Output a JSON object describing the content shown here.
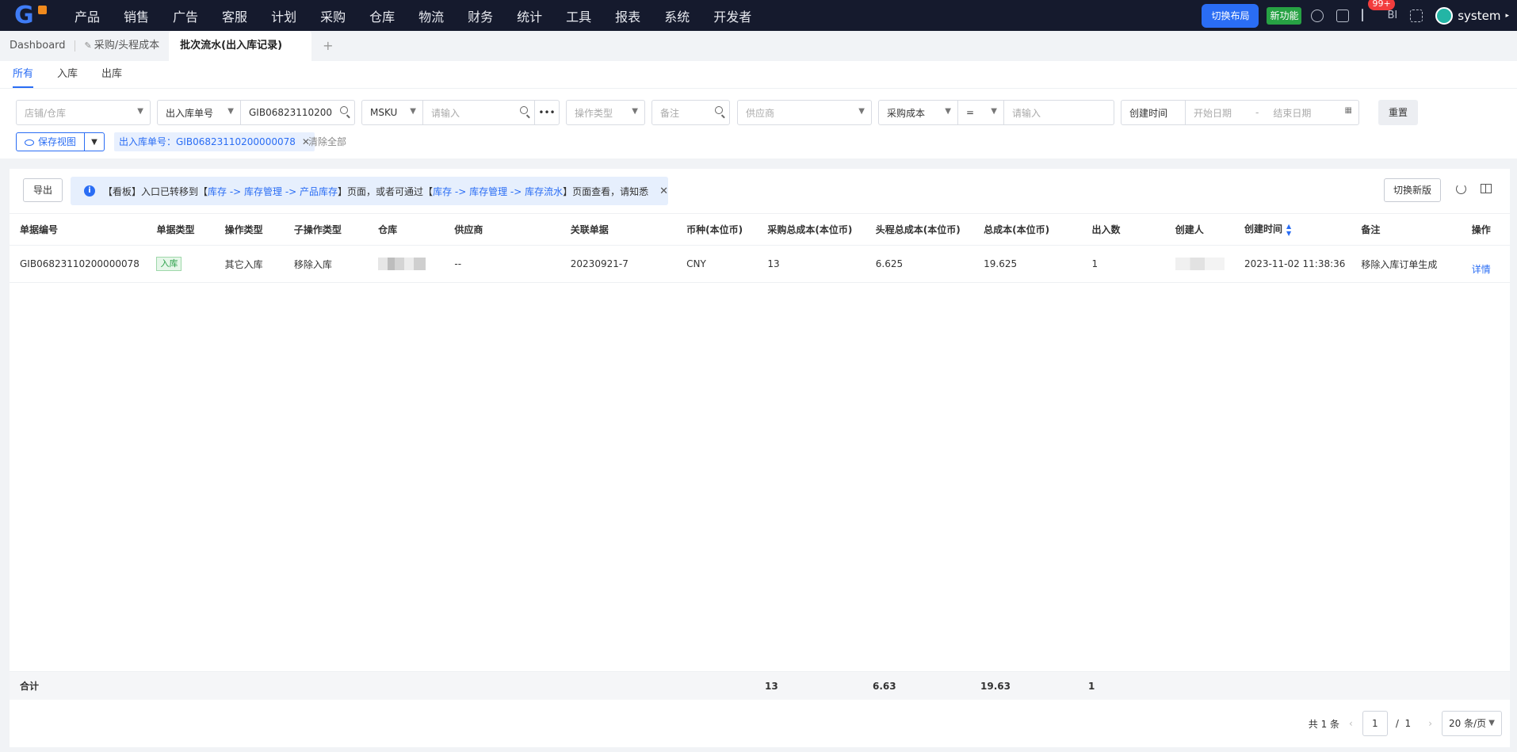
{
  "topnav": {
    "menu": [
      "产品",
      "销售",
      "广告",
      "客服",
      "计划",
      "采购",
      "仓库",
      "物流",
      "财务",
      "统计",
      "工具",
      "报表",
      "系统",
      "开发者"
    ],
    "switch_layout": "切换布局",
    "new_feature": "新功能",
    "badge": "99+",
    "bi_label": "BI",
    "user": "system"
  },
  "tabs": {
    "dashboard": "Dashboard",
    "purchase": "采购/头程成本",
    "active": "批次流水(出入库记录)",
    "add": "+"
  },
  "subtabs": [
    "所有",
    "入库",
    "出库"
  ],
  "filters": {
    "shop_warehouse": "店铺/仓库",
    "doc_no_type": "出入库单号",
    "doc_no_value": "GIB06823110200",
    "msku": "MSKU",
    "msku_placeholder": "请输入",
    "op_type": "操作类型",
    "remark": "备注",
    "supplier": "供应商",
    "cost_type": "采购成本",
    "operator": "=",
    "cost_placeholder": "请输入",
    "time_type": "创建时间",
    "start_date": "开始日期",
    "dash": "-",
    "end_date": "结束日期",
    "reset": "重置",
    "save_view": "保存视图",
    "active_tag": "出入库单号：GIB06823110200000078",
    "clear_all": "清除全部"
  },
  "toolbar": {
    "export": "导出",
    "notice_prefix": "【看板】入口已转移到【",
    "notice_link1": "库存 -> 库存管理 -> 产品库存",
    "notice_mid": "】页面，或者可通过【",
    "notice_link2": "库存 -> 库存管理 -> 库存流水",
    "notice_suffix": "】页面查看，请知悉",
    "switch_new": "切换新版"
  },
  "table": {
    "columns": [
      "单据编号",
      "单据类型",
      "操作类型",
      "子操作类型",
      "仓库",
      "供应商",
      "关联单据",
      "币种(本位币)",
      "采购总成本(本位币)",
      "头程总成本(本位币)",
      "总成本(本位币)",
      "出入数",
      "创建人",
      "创建时间",
      "备注",
      "操作"
    ],
    "rows": [
      {
        "doc_no": "GIB06823110200000078",
        "doc_type": "入库",
        "op_type": "其它入库",
        "sub_op_type": "移除入库",
        "supplier": "--",
        "related": "20230921-7",
        "currency": "CNY",
        "purchase_cost": "13",
        "first_leg_cost": "6.625",
        "total_cost": "19.625",
        "qty": "1",
        "created_at": "2023-11-02 11:38:36",
        "remark": "移除入库订单生成",
        "action": "详情"
      }
    ],
    "summary": {
      "label": "合计",
      "purchase_cost": "13",
      "first_leg_cost": "6.63",
      "total_cost": "19.63",
      "qty": "1"
    }
  },
  "pager": {
    "total": "共 1 条",
    "page": "1",
    "slash": "/",
    "pages": "1",
    "size": "20 条/页"
  }
}
